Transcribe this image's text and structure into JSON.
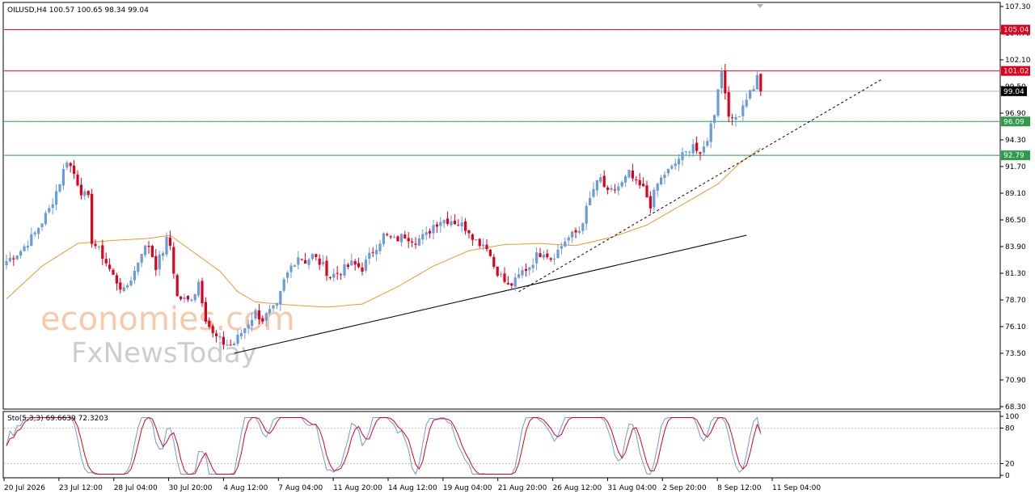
{
  "header": {
    "main_label": "OILUSD,H4  100.57 100.65 98.34 99.04",
    "osc_label": "Sto(5,3,3) 69.6639 72.3203"
  },
  "watermark": {
    "line1": "economies.com",
    "line2": "FxNewsToday"
  },
  "colors": {
    "bull": "#6b9bd8",
    "bear": "#e0001b",
    "ma": "#e89a2c",
    "resistance": "#e0001b",
    "support": "#2e9a4a",
    "last_price_line": "#b0b0b0",
    "stoch_main": "#6b9bd8",
    "stoch_signal": "#e0001b"
  },
  "chart_data": {
    "type": "candlestick",
    "symbol": "OILUSD",
    "timeframe": "H4",
    "ylim": [
      68.3,
      107.3
    ],
    "y_ticks": [
      "107.30",
      "104.70",
      "102.10",
      "99.50",
      "96.90",
      "94.30",
      "91.70",
      "89.10",
      "86.50",
      "83.90",
      "81.30",
      "78.70",
      "76.10",
      "73.50",
      "70.90",
      "68.30"
    ],
    "x_ticks": [
      "20 Jul 2026",
      "23 Jul 12:00",
      "28 Jul 04:00",
      "30 Jul 20:00",
      "4 Aug 12:00",
      "7 Aug 04:00",
      "11 Aug 20:00",
      "14 Aug 12:00",
      "19 Aug 04:00",
      "21 Aug 20:00",
      "26 Aug 12:00",
      "31 Aug 04:00",
      "2 Sep 20:00",
      "8 Sep 12:00",
      "11 Sep 04:00"
    ],
    "last_price": "99.04",
    "levels": [
      {
        "value": "105.04",
        "kind": "resistance"
      },
      {
        "value": "101.02",
        "kind": "resistance"
      },
      {
        "value": "96.09",
        "kind": "support"
      },
      {
        "value": "92.79",
        "kind": "support"
      }
    ],
    "close_path": [
      [
        0,
        82.5
      ],
      [
        4,
        83.5
      ],
      [
        8,
        85.2
      ],
      [
        12,
        87.5
      ],
      [
        15,
        90.2
      ],
      [
        17,
        92.4
      ],
      [
        19,
        91.0
      ],
      [
        21,
        89.3
      ],
      [
        23,
        88.5
      ],
      [
        24,
        84.5
      ],
      [
        27,
        83.0
      ],
      [
        30,
        81.0
      ],
      [
        33,
        79.5
      ],
      [
        36,
        81.5
      ],
      [
        38,
        83.5
      ],
      [
        40,
        84.0
      ],
      [
        42,
        82.0
      ],
      [
        44,
        83.5
      ],
      [
        45,
        84.5
      ],
      [
        46,
        84.0
      ],
      [
        48,
        79.0
      ],
      [
        51,
        78.6
      ],
      [
        53,
        79.5
      ],
      [
        54,
        80.5
      ],
      [
        56,
        77.0
      ],
      [
        58,
        75.3
      ],
      [
        61,
        74.5
      ],
      [
        63,
        74.3
      ],
      [
        64,
        74.5
      ],
      [
        66,
        75.5
      ],
      [
        68,
        76.5
      ],
      [
        70,
        77.5
      ],
      [
        72,
        76.8
      ],
      [
        74,
        77.5
      ],
      [
        76,
        78.0
      ],
      [
        78,
        80.5
      ],
      [
        80,
        82.0
      ],
      [
        82,
        83.0
      ],
      [
        84,
        82.5
      ],
      [
        86,
        83.0
      ],
      [
        89,
        82.0
      ],
      [
        91,
        81.0
      ],
      [
        94,
        81.5
      ],
      [
        97,
        82.2
      ],
      [
        100,
        81.8
      ],
      [
        103,
        83.5
      ],
      [
        106,
        85.0
      ],
      [
        109,
        84.5
      ],
      [
        112,
        85.0
      ],
      [
        115,
        84.5
      ],
      [
        118,
        85.0
      ],
      [
        120,
        86.0
      ],
      [
        122,
        86.5
      ],
      [
        125,
        86.5
      ],
      [
        128,
        86.0
      ],
      [
        130,
        85.5
      ],
      [
        132,
        84.5
      ],
      [
        135,
        84.0
      ],
      [
        137,
        82.0
      ],
      [
        139,
        81.0
      ],
      [
        141,
        80.0
      ],
      [
        143,
        80.5
      ],
      [
        145,
        81.5
      ],
      [
        147,
        82.0
      ],
      [
        149,
        83.0
      ],
      [
        151,
        83.5
      ],
      [
        153,
        82.8
      ],
      [
        155,
        83.5
      ],
      [
        157,
        84.5
      ],
      [
        159,
        85.0
      ],
      [
        161,
        85.5
      ],
      [
        163,
        87.5
      ],
      [
        165,
        89.5
      ],
      [
        167,
        90.5
      ],
      [
        169,
        89.0
      ],
      [
        171,
        89.5
      ],
      [
        173,
        90.0
      ],
      [
        175,
        91.0
      ],
      [
        177,
        90.0
      ],
      [
        179,
        89.5
      ],
      [
        181,
        88.0
      ],
      [
        183,
        90.0
      ],
      [
        185,
        91.0
      ],
      [
        187,
        91.5
      ],
      [
        189,
        92.5
      ],
      [
        191,
        93.0
      ],
      [
        193,
        94.0
      ],
      [
        195,
        92.5
      ],
      [
        197,
        94.5
      ],
      [
        199,
        97.0
      ],
      [
        200,
        99.5
      ],
      [
        201,
        101.0
      ],
      [
        202,
        99.0
      ],
      [
        203,
        97.0
      ],
      [
        204,
        96.0
      ],
      [
        206,
        97.0
      ],
      [
        208,
        98.5
      ],
      [
        210,
        99.5
      ],
      [
        211,
        100.4
      ],
      [
        212,
        99.04
      ]
    ],
    "ma": [
      [
        0,
        78.8
      ],
      [
        10,
        82.0
      ],
      [
        20,
        84.2
      ],
      [
        30,
        84.5
      ],
      [
        40,
        84.7
      ],
      [
        46,
        85.0
      ],
      [
        52,
        83.5
      ],
      [
        60,
        81.5
      ],
      [
        65,
        79.5
      ],
      [
        70,
        78.5
      ],
      [
        80,
        78.2
      ],
      [
        90,
        78.0
      ],
      [
        100,
        78.3
      ],
      [
        110,
        80.0
      ],
      [
        120,
        82.0
      ],
      [
        130,
        83.5
      ],
      [
        140,
        84.1
      ],
      [
        150,
        84.2
      ],
      [
        160,
        84.0
      ],
      [
        170,
        84.8
      ],
      [
        180,
        86.0
      ],
      [
        190,
        88.0
      ],
      [
        200,
        90.0
      ],
      [
        206,
        92.0
      ],
      [
        212,
        93.5
      ]
    ],
    "trendlines": [
      {
        "style": "solid",
        "points": [
          [
            64,
            73.5
          ],
          [
            208,
            85.0
          ]
        ]
      },
      {
        "style": "dashed",
        "points": [
          [
            144,
            79.5
          ],
          [
            246,
            100.2
          ]
        ]
      }
    ],
    "stochastic": {
      "name": "Sto(5,3,3)",
      "main_value": "69.6639",
      "signal_value": "72.3203",
      "levels": [
        "80",
        "20"
      ],
      "ylim": [
        0,
        100
      ],
      "y_ticks": [
        "100",
        "80",
        "20",
        "0"
      ]
    }
  }
}
